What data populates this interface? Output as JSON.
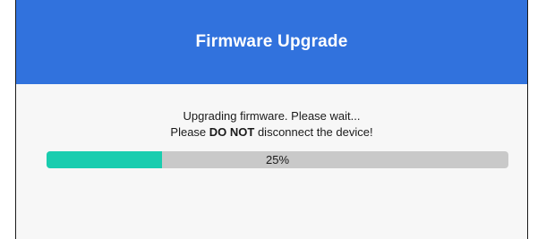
{
  "dialog": {
    "title": "Firmware Upgrade"
  },
  "message": {
    "line1": "Upgrading firmware. Please wait...",
    "line2_prefix": "Please ",
    "line2_emphasis": "DO NOT",
    "line2_suffix": " disconnect the device!"
  },
  "progress": {
    "value": 0.25,
    "label": "25%"
  },
  "colors": {
    "header": "#3172dd",
    "progress_fill": "#19cdaf",
    "progress_track": "#c9c9c9"
  }
}
